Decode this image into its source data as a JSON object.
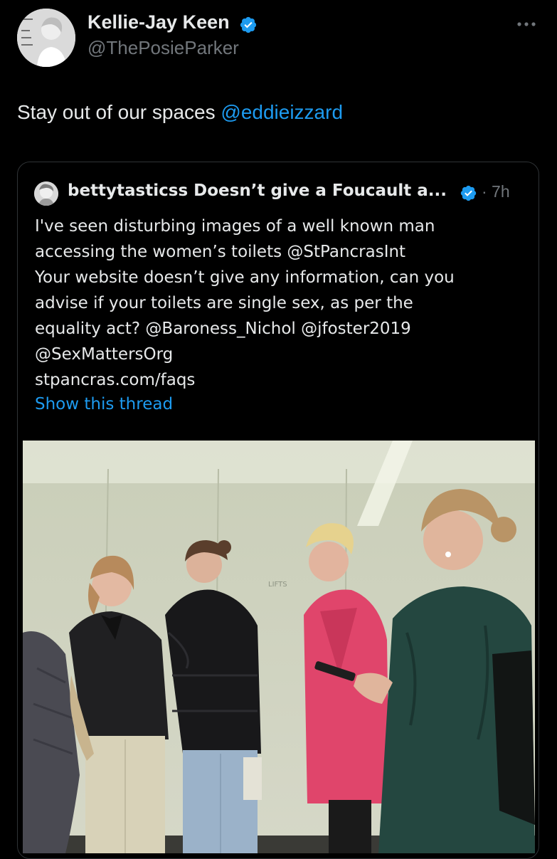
{
  "tweet": {
    "author_name": "Kellie-Jay Keen",
    "author_handle": "@ThePosieParker",
    "text_prefix": "Stay out of our spaces ",
    "text_mention": "@eddieizzard",
    "icons": {
      "avatar": "avatar-photo",
      "verified": "verified-badge-icon",
      "more": "more-options-icon"
    }
  },
  "quote": {
    "author_name": "bettytasticss Doesn’t give a Foucault a...",
    "time": "· 7h",
    "lines": {
      "l1": "I've seen disturbing images of a well known man",
      "l2_prefix": "accessing the women’s toilets ",
      "l2_mention": "@StPancrasInt",
      "l3": "Your website doesn’t give any information, can you",
      "l4": "advise if your toilets are single sex, as per the",
      "l5_prefix": "equality act? ",
      "l5_mention1": "@Baroness_Nichol",
      "l5_space": " ",
      "l5_mention2": "@jfoster2019",
      "l6": "@SexMattersOrg",
      "l7": "stpancras.com/faqs"
    },
    "show_thread": "Show this thread",
    "photo_sign_text": "LIFTS"
  },
  "colors": {
    "background": "#000000",
    "text": "#e7e9ea",
    "secondary": "#71767b",
    "link": "#1d9bf0",
    "border": "#2f3336"
  }
}
